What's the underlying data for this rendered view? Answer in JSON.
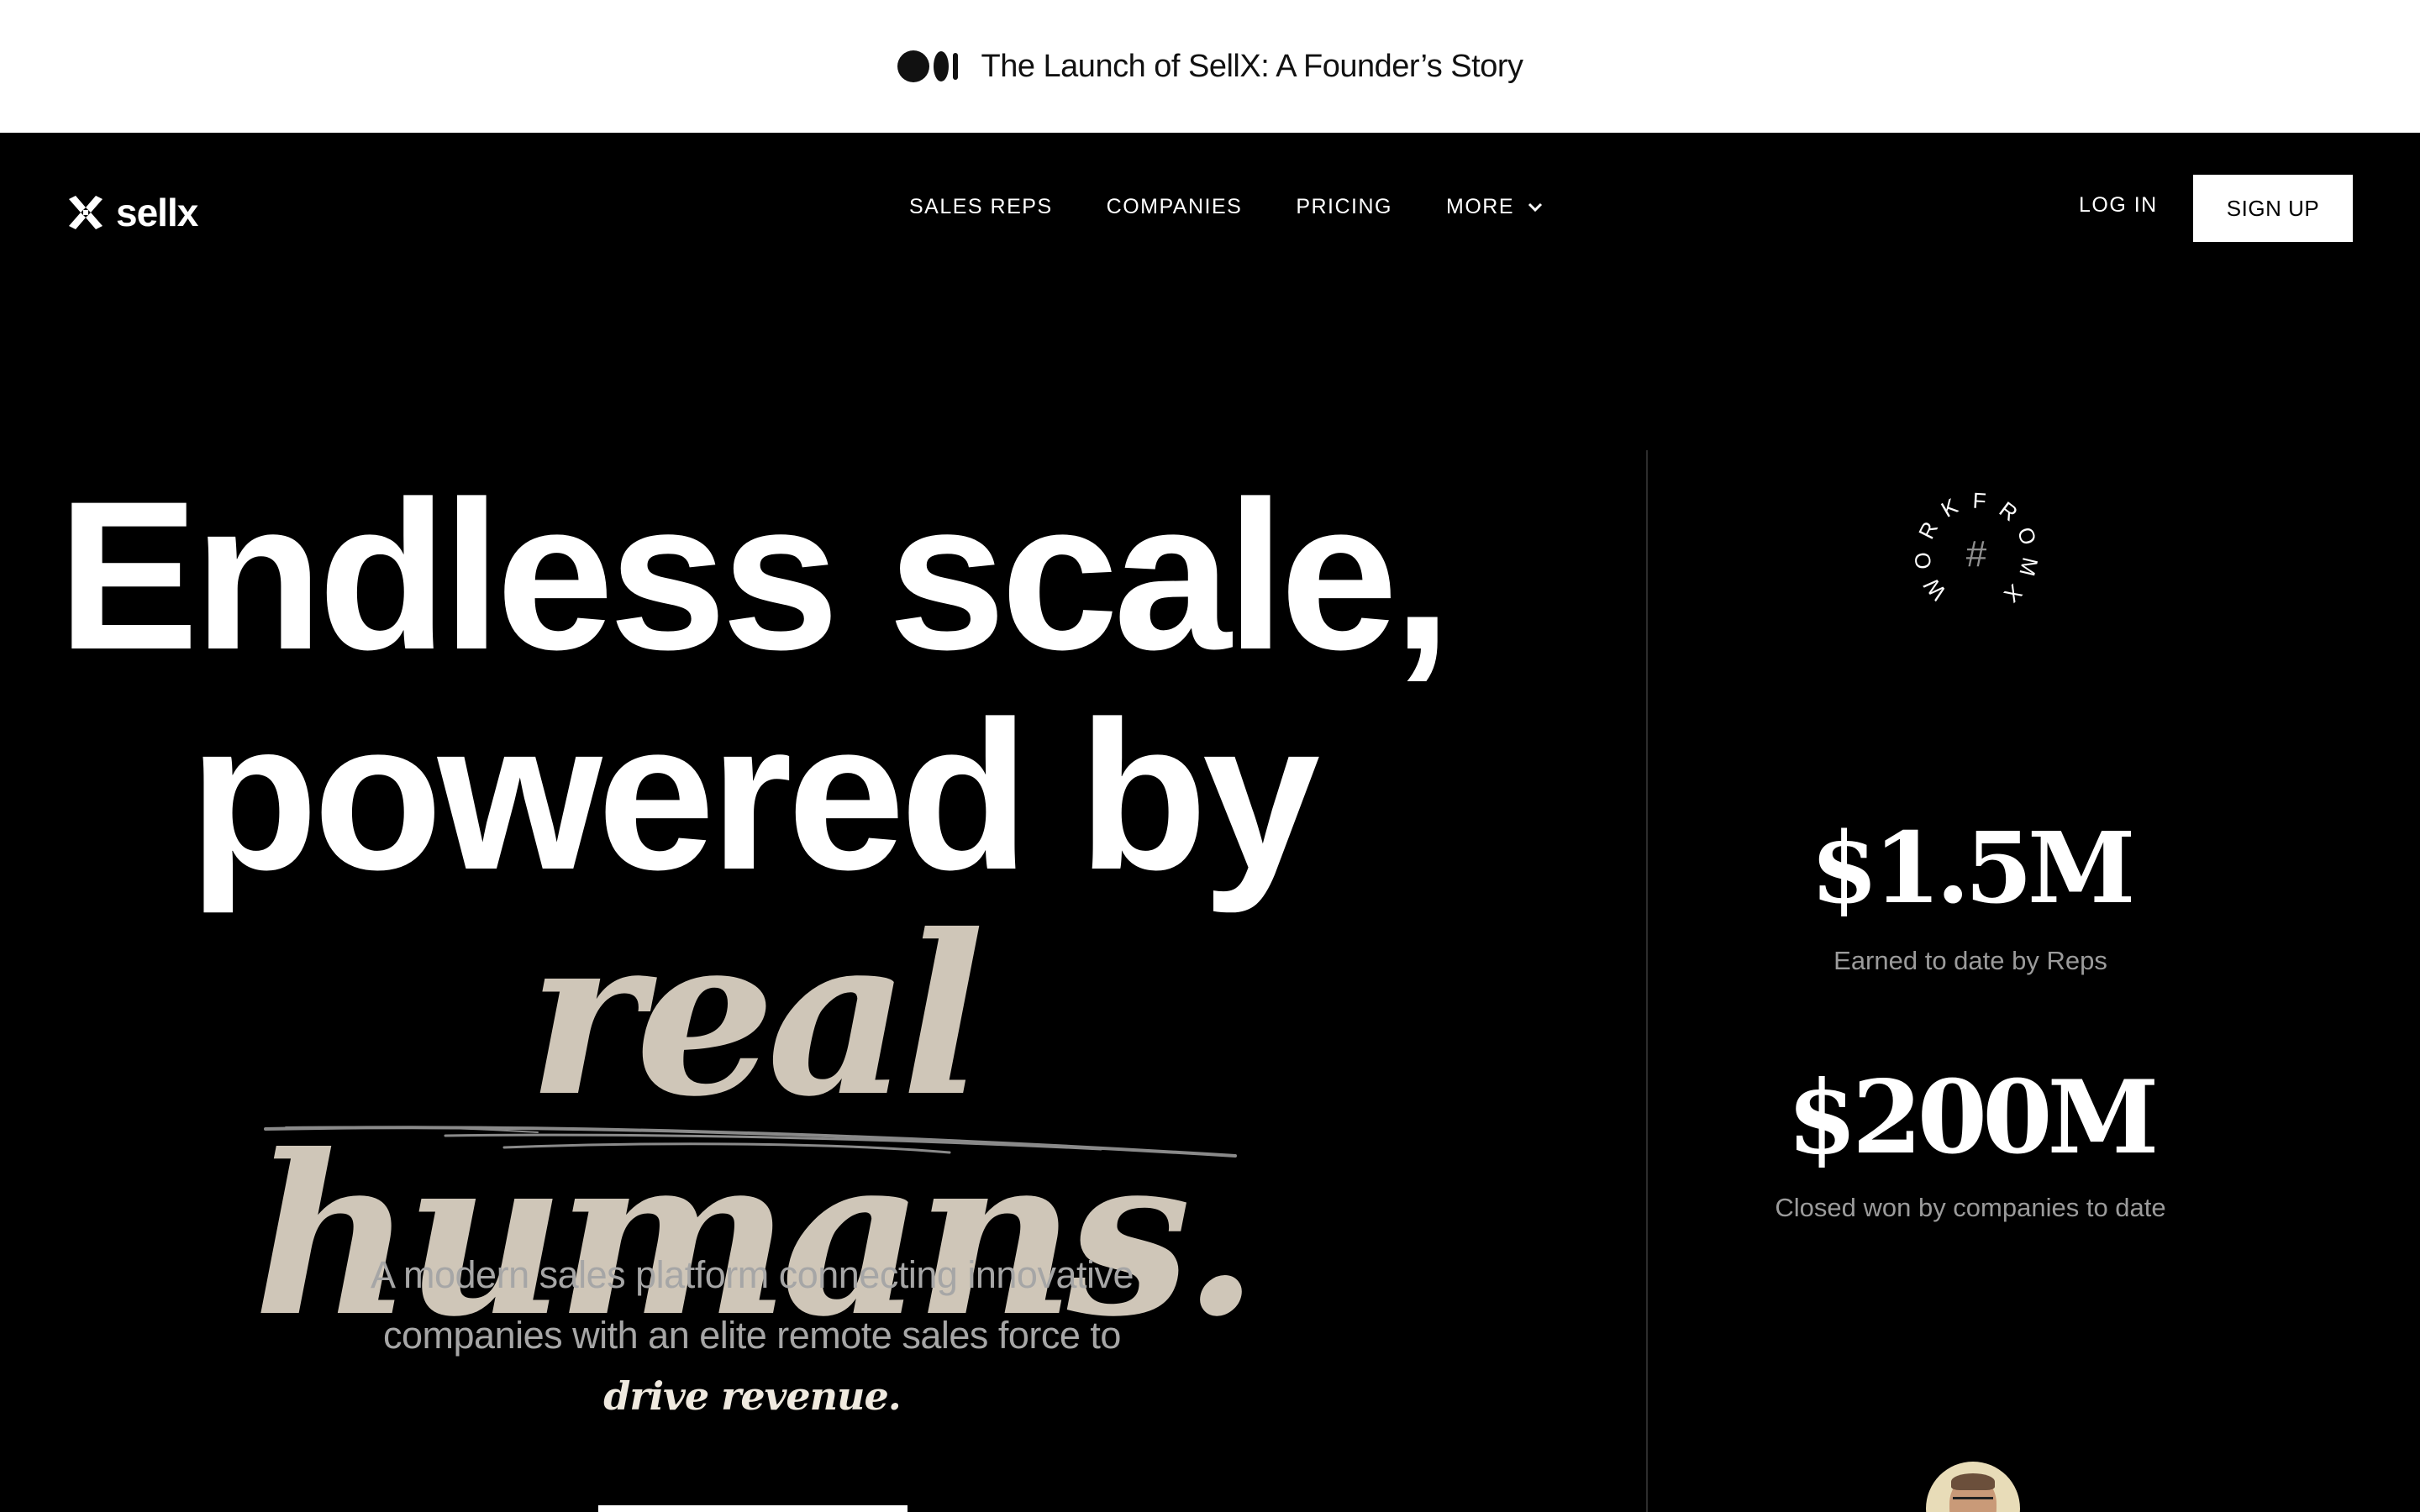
{
  "announcement": {
    "icon": "medium-logo-icon",
    "text": "The Launch of SellX: A Founder’s Story"
  },
  "nav": {
    "logo_text": "sellx",
    "links": [
      {
        "label": "SALES REPS"
      },
      {
        "label": "COMPANIES"
      },
      {
        "label": "PRICING"
      },
      {
        "label": "MORE",
        "icon": "chevron-down-icon"
      }
    ],
    "login_label": "LOG IN",
    "signup_label": "SIGN UP"
  },
  "hero": {
    "line1": "Endless scale,",
    "line2": "powered by",
    "line3": "real humans.",
    "subtitle_plain": "A modern sales platform connecting innovative companies with an elite remote sales force to",
    "subtitle_emphasis": "drive revenue."
  },
  "badge": {
    "ring_text": "WORKFROMX",
    "center": "#"
  },
  "stats": [
    {
      "value": "$1.5M",
      "label": "Earned to date by Reps"
    },
    {
      "value": "$200M",
      "label": "Closed won by companies to date"
    }
  ],
  "colors": {
    "background": "#000000",
    "accent_serif": "#cfc6b8",
    "muted_text": "#a6a6a6"
  }
}
